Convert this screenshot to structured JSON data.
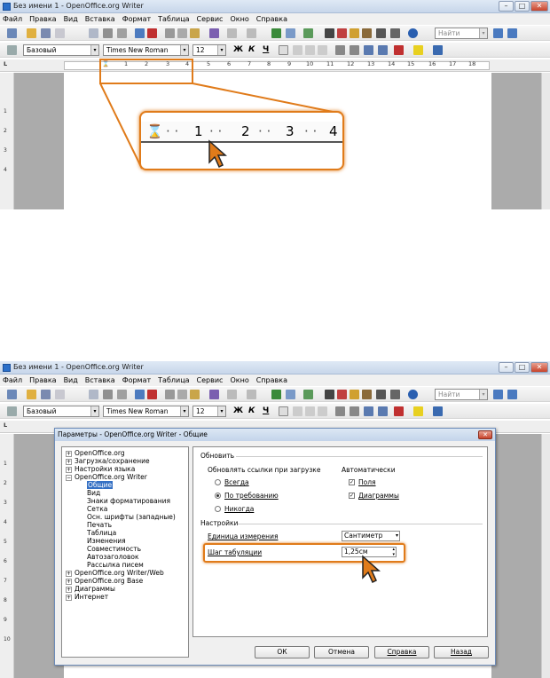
{
  "window": {
    "title": "Без имени 1 - OpenOffice.org Writer",
    "min": "–",
    "max": "□",
    "close": "✕"
  },
  "menu": [
    "Файл",
    "Правка",
    "Вид",
    "Вставка",
    "Формат",
    "Таблица",
    "Сервис",
    "Окно",
    "Справка"
  ],
  "toolbar": {
    "search_placeholder": "Найти",
    "style": "Базовый",
    "font": "Times New Roman",
    "size": "12",
    "bold": "Ж",
    "italic": "К",
    "underline": "Ч"
  },
  "ruler": {
    "marks": [
      "1",
      "2",
      "3",
      "4",
      "5",
      "6",
      "7",
      "8",
      "9",
      "10",
      "11",
      "12",
      "13",
      "14",
      "15",
      "16",
      "17",
      "18"
    ],
    "vmarks": [
      "1",
      "2",
      "3",
      "4"
    ],
    "vmarks_bottom": [
      "1",
      "2",
      "3",
      "4",
      "5",
      "6",
      "7",
      "8",
      "9",
      "10"
    ]
  },
  "zoom": {
    "marks": [
      "1",
      "2",
      "3",
      "4"
    ]
  },
  "dialog": {
    "title": "Параметры - OpenOffice.org Writer - Общие",
    "close": "✕",
    "tree": [
      {
        "label": "OpenOffice.org",
        "level": 0,
        "expander": "+"
      },
      {
        "label": "Загрузка/сохранение",
        "level": 0,
        "expander": "+"
      },
      {
        "label": "Настройки языка",
        "level": 0,
        "expander": "+"
      },
      {
        "label": "OpenOffice.org Writer",
        "level": 0,
        "expander": "−"
      },
      {
        "label": "Общие",
        "level": 1,
        "selected": true
      },
      {
        "label": "Вид",
        "level": 1
      },
      {
        "label": "Знаки форматирования",
        "level": 1
      },
      {
        "label": "Сетка",
        "level": 1
      },
      {
        "label": "Осн. шрифты (западные)",
        "level": 1
      },
      {
        "label": "Печать",
        "level": 1
      },
      {
        "label": "Таблица",
        "level": 1
      },
      {
        "label": "Изменения",
        "level": 1
      },
      {
        "label": "Совместимость",
        "level": 1
      },
      {
        "label": "Автозаголовок",
        "level": 1
      },
      {
        "label": "Рассылка писем",
        "level": 1
      },
      {
        "label": "OpenOffice.org Writer/Web",
        "level": 0,
        "expander": "+"
      },
      {
        "label": "OpenOffice.org Base",
        "level": 0,
        "expander": "+"
      },
      {
        "label": "Диаграммы",
        "level": 0,
        "expander": "+"
      },
      {
        "label": "Интернет",
        "level": 0,
        "expander": "+"
      }
    ],
    "update_section": "Обновить",
    "update_links_label": "Обновлять ссылки при загрузке",
    "radios": [
      {
        "label": "Всегда",
        "checked": false
      },
      {
        "label": "По требованию",
        "checked": true
      },
      {
        "label": "Никогда",
        "checked": false
      }
    ],
    "auto_label": "Автоматически",
    "checks": [
      {
        "label": "Поля",
        "checked": true
      },
      {
        "label": "Диаграммы",
        "checked": true
      }
    ],
    "settings_section": "Настройки",
    "unit_label": "Единица измерения",
    "unit_value": "Сантиметр",
    "tab_label": "Шаг табуляции",
    "tab_value": "1,25см",
    "buttons": {
      "ok": "ОК",
      "cancel": "Отмена",
      "help": "Справка",
      "back": "Назад"
    }
  },
  "colors": {
    "accent": "#e07b1a",
    "selection": "#3470c4"
  }
}
